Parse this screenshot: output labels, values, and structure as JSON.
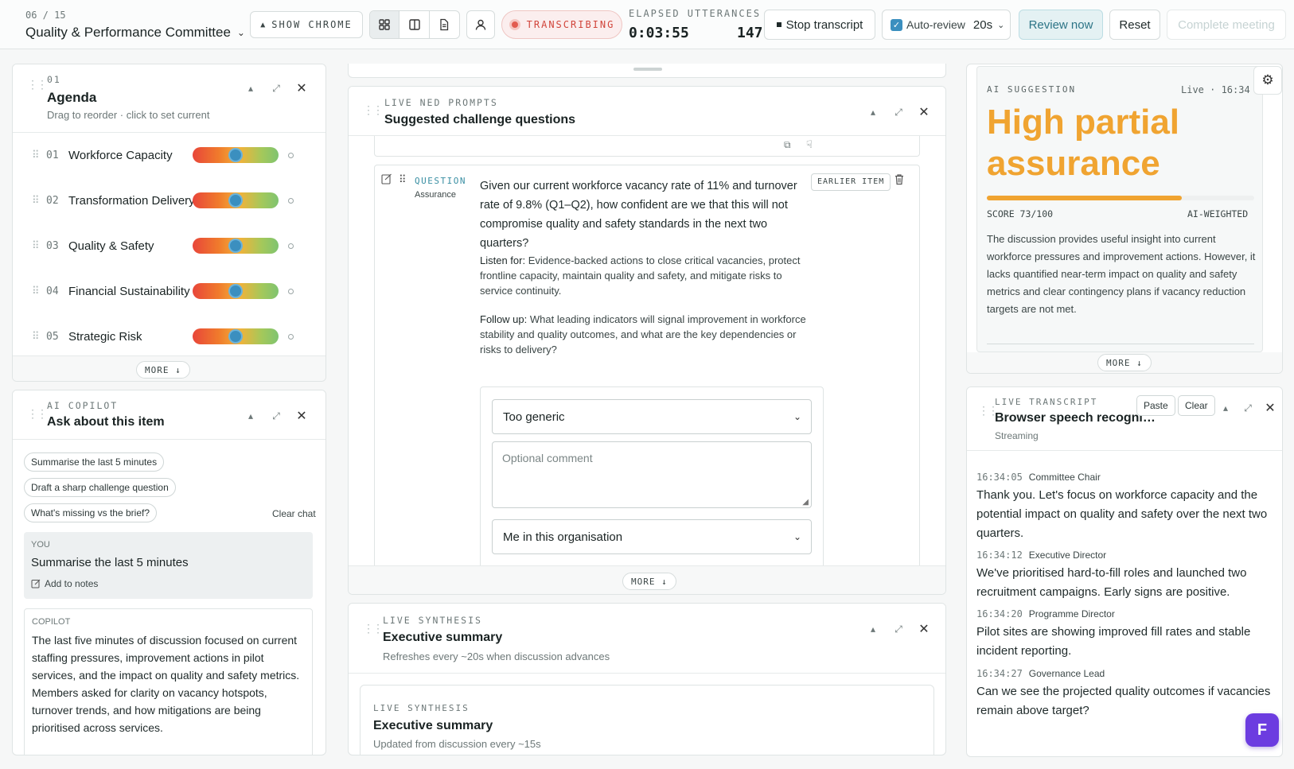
{
  "header": {
    "meeting_count": "06 / 15",
    "meeting_title": "Quality & Performance Committee",
    "show_chrome": "SHOW CHROME",
    "transcribing": "TRANSCRIBING",
    "elapsed_label": "ELAPSED UTTERANCES",
    "elapsed_value": "0:03:55",
    "utterances_value": "147",
    "stop_transcript": "Stop transcript",
    "auto_review_label": "Auto-review",
    "auto_review_interval": "20s",
    "review_now": "Review now",
    "reset": "Reset",
    "complete_meeting": "Complete meeting"
  },
  "agenda": {
    "eyebrow": "01",
    "title": "Agenda",
    "subtitle": "Drag to reorder · click to set current",
    "items": [
      {
        "num": "01",
        "title": "Workforce Capacity",
        "level": 0.5
      },
      {
        "num": "02",
        "title": "Transformation Delivery",
        "level": 0.5
      },
      {
        "num": "03",
        "title": "Quality & Safety",
        "level": 0.5
      },
      {
        "num": "04",
        "title": "Financial Sustainability",
        "level": 0.5
      },
      {
        "num": "05",
        "title": "Strategic Risk",
        "level": 0.5
      }
    ],
    "more": "MORE ↓"
  },
  "copilot": {
    "eyebrow": "AI COPILOT",
    "title": "Ask about this item",
    "chips": [
      "Summarise the last 5 minutes",
      "Draft a sharp challenge question",
      "What's missing vs the brief?"
    ],
    "clear_chat": "Clear chat",
    "you_label": "YOU",
    "you_text": "Summarise the last 5 minutes",
    "add_to_notes": "Add to notes",
    "copilot_label": "COPILOT",
    "copilot_text": "The last five minutes of discussion focused on current staffing pressures, improvement actions in pilot services, and the impact on quality and safety metrics. Members asked for clarity on vacancy hotspots, turnover trends, and how mitigations are being prioritised across services."
  },
  "prompts": {
    "eyebrow": "LIVE NED PROMPTS",
    "title": "Suggested challenge questions",
    "question_label": "QUESTION",
    "question_type": "Assurance",
    "earlier_item": "EARLIER ITEM",
    "question_text": "Given our current workforce vacancy rate of 11% and turnover rate of 9.8% (Q1–Q2), how confident are we that this will not compromise quality and safety standards in the next two quarters?",
    "listen_label": "Listen for:",
    "listen_text": "Evidence-backed actions to close critical vacancies, protect frontline capacity, maintain quality and safety, and mitigate risks to service continuity.",
    "follow_label": "Follow up:",
    "follow_text": "What leading indicators will signal improvement in workforce stability and quality outcomes, and what are the key dependencies or risks to delivery?",
    "feedback_select": "Too generic",
    "comment_placeholder": "Optional comment",
    "audience_select": "Me in this organisation",
    "more": "MORE ↓"
  },
  "synthesis": {
    "eyebrow": "LIVE SYNTHESIS",
    "title": "Executive summary",
    "subtitle": "Refreshes every ~20s when discussion advances",
    "inner_eyebrow": "LIVE SYNTHESIS",
    "inner_title": "Executive summary",
    "inner_subtitle": "Updated from discussion every ~15s"
  },
  "suggestion": {
    "eyebrow": "AI SUGGESTION",
    "live": "Live · 16:34",
    "headline": "High partial assurance",
    "score_label": "SCORE 73/100",
    "score": 73,
    "weighted": "AI-WEIGHTED",
    "body": "The discussion provides useful insight into current workforce pressures and improvement actions. However, it lacks quantified near-term impact on quality and safety metrics and clear contingency plans if vacancy reduction targets are not met.",
    "more": "MORE ↓",
    "accent": "#f0a431"
  },
  "transcript": {
    "eyebrow": "LIVE TRANSCRIPT",
    "title": "Browser speech recogni…",
    "status": "Streaming",
    "paste": "Paste",
    "clear": "Clear",
    "entries": [
      {
        "time": "16:34:05",
        "speaker": "Committee Chair",
        "text": "Thank you. Let's focus on workforce capacity and the potential impact on quality and safety over the next two quarters."
      },
      {
        "time": "16:34:12",
        "speaker": "Executive Director",
        "text": "We've prioritised hard-to-fill roles and launched two recruitment campaigns. Early signs are positive."
      },
      {
        "time": "16:34:20",
        "speaker": "Programme Director",
        "text": "Pilot sites are showing improved fill rates and stable incident reporting."
      },
      {
        "time": "16:34:27",
        "speaker": "Governance Lead",
        "text": "Can we see the projected quality outcomes if vacancies remain above target?"
      }
    ]
  },
  "fab": "F"
}
